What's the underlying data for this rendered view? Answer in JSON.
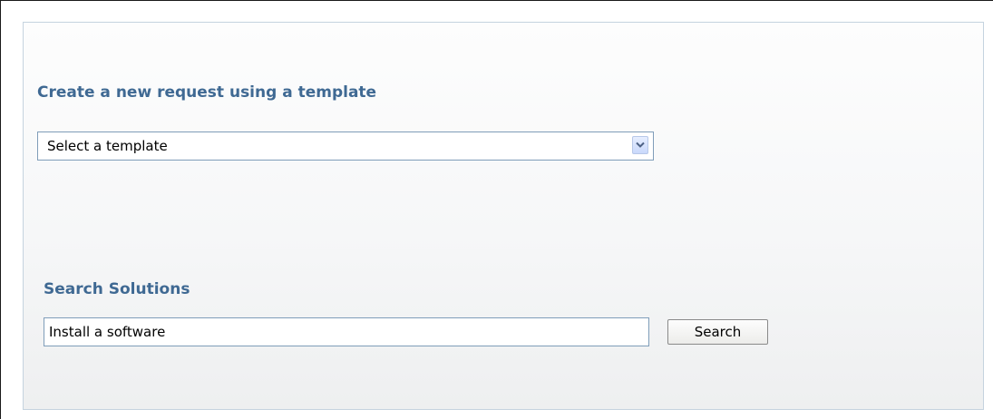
{
  "template_section": {
    "heading": "Create a new request using a template",
    "select": {
      "selected_value": "Select a template",
      "arrow_icon": "chevron-down-icon"
    }
  },
  "search_section": {
    "heading": "Search Solutions",
    "input_value": "Install a software",
    "button_label": "Search"
  },
  "colors": {
    "heading": "#3f6993",
    "panel_border": "#c5d3df",
    "field_border": "#7f9db9"
  }
}
